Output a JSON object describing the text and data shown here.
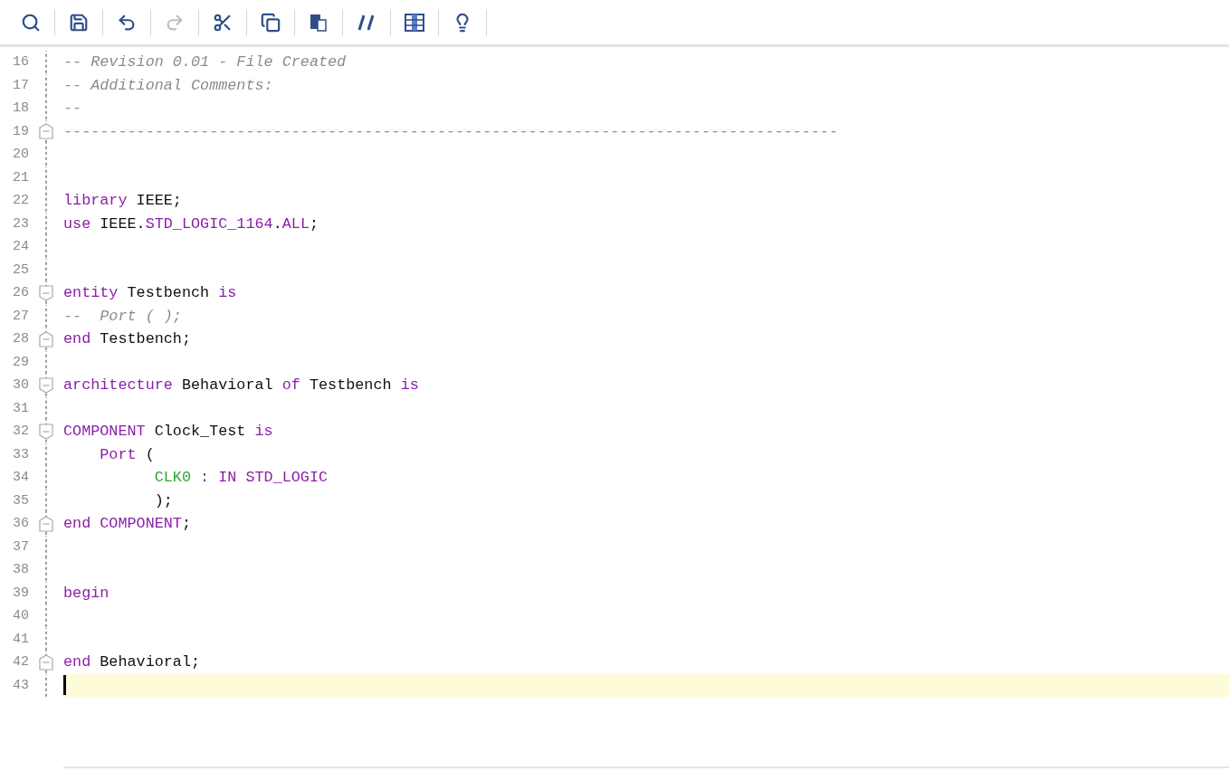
{
  "toolbar": [
    {
      "kind": "search",
      "disabled": false
    },
    {
      "kind": "save",
      "disabled": false
    },
    {
      "kind": "undo",
      "disabled": false
    },
    {
      "kind": "redo",
      "disabled": true
    },
    {
      "kind": "cut",
      "disabled": false
    },
    {
      "kind": "copy",
      "disabled": false
    },
    {
      "kind": "paste",
      "disabled": false
    },
    {
      "kind": "comment",
      "disabled": false
    },
    {
      "kind": "columns",
      "disabled": false
    },
    {
      "kind": "hint",
      "disabled": false
    }
  ],
  "editor": {
    "lines": [
      {
        "number": "16",
        "fold_start": false,
        "fold_end": false,
        "current": false,
        "tokens": [
          {
            "kind": "comment",
            "text": "-- Revision 0.01 - File Created"
          }
        ]
      },
      {
        "number": "17",
        "fold_start": false,
        "fold_end": false,
        "current": false,
        "tokens": [
          {
            "kind": "comment",
            "text": "-- Additional Comments:"
          }
        ]
      },
      {
        "number": "18",
        "fold_start": false,
        "fold_end": false,
        "current": false,
        "tokens": [
          {
            "kind": "comment",
            "text": "--"
          }
        ]
      },
      {
        "number": "19",
        "fold_start": false,
        "fold_end": true,
        "current": false,
        "tokens": [
          {
            "kind": "comment",
            "text": "-------------------------------------------------------------------------------------"
          }
        ]
      },
      {
        "number": "20",
        "fold_start": false,
        "fold_end": false,
        "current": false
      },
      {
        "number": "21",
        "fold_start": false,
        "fold_end": false,
        "current": false
      },
      {
        "number": "22",
        "fold_start": false,
        "fold_end": false,
        "current": false,
        "tokens": [
          {
            "kind": "keyword",
            "text": "library"
          },
          {
            "kind": "plain",
            "text": " IEEE;"
          }
        ]
      },
      {
        "number": "23",
        "fold_start": false,
        "fold_end": false,
        "current": false,
        "tokens": [
          {
            "kind": "keyword",
            "text": "use"
          },
          {
            "kind": "plain",
            "text": " IEEE."
          },
          {
            "kind": "keyword",
            "text": "STD_LOGIC_1164"
          },
          {
            "kind": "plain",
            "text": "."
          },
          {
            "kind": "keyword",
            "text": "ALL"
          },
          {
            "kind": "plain",
            "text": ";"
          }
        ]
      },
      {
        "number": "24",
        "fold_start": false,
        "fold_end": false,
        "current": false
      },
      {
        "number": "25",
        "fold_start": false,
        "fold_end": false,
        "current": false
      },
      {
        "number": "26",
        "fold_start": true,
        "fold_end": false,
        "current": false,
        "tokens": [
          {
            "kind": "keyword",
            "text": "entity"
          },
          {
            "kind": "plain",
            "text": " Testbench "
          },
          {
            "kind": "keyword",
            "text": "is"
          }
        ]
      },
      {
        "number": "27",
        "fold_start": false,
        "fold_end": false,
        "current": false,
        "tokens": [
          {
            "kind": "comment",
            "text": "--  Port ( );"
          }
        ]
      },
      {
        "number": "28",
        "fold_start": false,
        "fold_end": true,
        "current": false,
        "tokens": [
          {
            "kind": "keyword",
            "text": "end"
          },
          {
            "kind": "plain",
            "text": " Testbench;"
          }
        ]
      },
      {
        "number": "29",
        "fold_start": false,
        "fold_end": false,
        "current": false
      },
      {
        "number": "30",
        "fold_start": true,
        "fold_end": false,
        "current": false,
        "tokens": [
          {
            "kind": "keyword",
            "text": "architecture"
          },
          {
            "kind": "plain",
            "text": " Behavioral "
          },
          {
            "kind": "keyword",
            "text": "of"
          },
          {
            "kind": "plain",
            "text": " Testbench "
          },
          {
            "kind": "keyword",
            "text": "is"
          }
        ]
      },
      {
        "number": "31",
        "fold_start": false,
        "fold_end": false,
        "current": false
      },
      {
        "number": "32",
        "fold_start": true,
        "fold_end": false,
        "current": false,
        "tokens": [
          {
            "kind": "keyword",
            "text": "COMPONENT"
          },
          {
            "kind": "plain",
            "text": " Clock_Test "
          },
          {
            "kind": "keyword",
            "text": "is"
          }
        ]
      },
      {
        "number": "33",
        "fold_start": false,
        "fold_end": false,
        "current": false,
        "tokens": [
          {
            "kind": "keyword",
            "text": "    Port"
          },
          {
            "kind": "plain",
            "text": " ("
          }
        ]
      },
      {
        "number": "34",
        "fold_start": false,
        "fold_end": false,
        "current": false,
        "tokens": [
          {
            "kind": "signal",
            "text": "          CLK0"
          },
          {
            "kind": "keyword",
            "text": " : IN STD_LOGIC"
          }
        ]
      },
      {
        "number": "35",
        "fold_start": false,
        "fold_end": false,
        "current": false,
        "tokens": [
          {
            "kind": "plain",
            "text": "          );"
          }
        ]
      },
      {
        "number": "36",
        "fold_start": false,
        "fold_end": true,
        "current": false,
        "tokens": [
          {
            "kind": "keyword",
            "text": "end COMPONENT"
          },
          {
            "kind": "plain",
            "text": ";"
          }
        ]
      },
      {
        "number": "37",
        "fold_start": false,
        "fold_end": false,
        "current": false
      },
      {
        "number": "38",
        "fold_start": false,
        "fold_end": false,
        "current": false
      },
      {
        "number": "39",
        "fold_start": false,
        "fold_end": false,
        "current": false,
        "tokens": [
          {
            "kind": "keyword",
            "text": "begin"
          }
        ]
      },
      {
        "number": "40",
        "fold_start": false,
        "fold_end": false,
        "current": false
      },
      {
        "number": "41",
        "fold_start": false,
        "fold_end": false,
        "current": false
      },
      {
        "number": "42",
        "fold_start": false,
        "fold_end": true,
        "current": false,
        "tokens": [
          {
            "kind": "keyword",
            "text": "end"
          },
          {
            "kind": "plain",
            "text": " Behavioral;"
          }
        ]
      },
      {
        "number": "43",
        "fold_start": false,
        "fold_end": false,
        "current": true
      }
    ]
  }
}
